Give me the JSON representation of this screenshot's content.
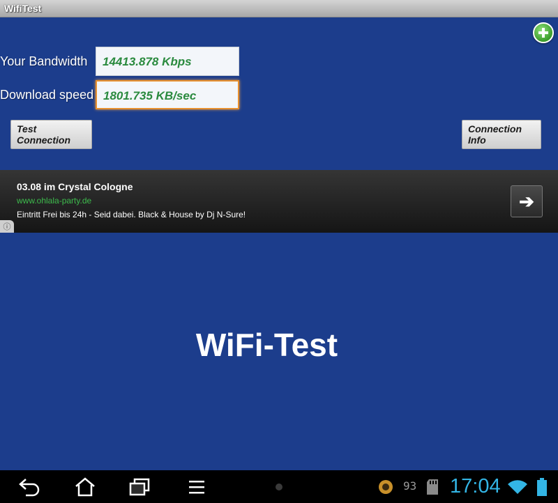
{
  "window": {
    "title": "WifiTest"
  },
  "fields": {
    "bandwidth": {
      "label": "Your Bandwidth",
      "value": "14413.878 Kbps"
    },
    "download": {
      "label": "Download speed",
      "value": "1801.735 KB/sec"
    }
  },
  "buttons": {
    "test": "Test Connection",
    "info": "Connection Info",
    "add_icon": "plus-icon"
  },
  "ad": {
    "title": "03.08 im Crystal Cologne",
    "url": "www.ohlala-party.de",
    "description": "Eintritt Frei bis 24h - Seid dabei. Black & House by Dj N-Sure!",
    "arrow_icon": "arrow-right-icon",
    "info_icon": "info-icon"
  },
  "main": {
    "title": "WiFi-Test"
  },
  "navbar": {
    "icons": [
      "back-icon",
      "home-icon",
      "recent-apps-icon",
      "menu-icon"
    ],
    "notification_count": "93",
    "time": "17:04",
    "status_icons": [
      "app-notification-icon",
      "sd-card-icon",
      "wifi-icon",
      "battery-icon"
    ]
  },
  "colors": {
    "background": "#1c3d8c",
    "value_text": "#2a8a3e",
    "focus_border": "#e8902e",
    "clock": "#33b5e5",
    "ad_url": "#3dbb4c"
  }
}
